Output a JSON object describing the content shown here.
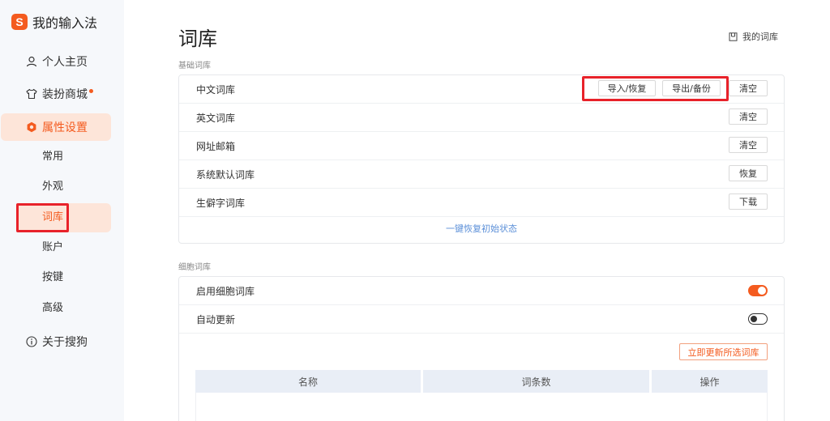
{
  "brand": {
    "logo_letter": "S",
    "name": "我的输入法",
    "color": "#f45b1f"
  },
  "sidebar": {
    "items": [
      {
        "label": "个人主页",
        "icon": "user-icon"
      },
      {
        "label": "装扮商城",
        "icon": "shirt-icon",
        "badge": true
      },
      {
        "label": "属性设置",
        "icon": "settings-icon",
        "active": true
      },
      {
        "label": "关于搜狗",
        "icon": "info-icon"
      }
    ],
    "sub_items": [
      "常用",
      "外观",
      "词库",
      "账户",
      "按键",
      "高级"
    ],
    "active_sub": "词库"
  },
  "main": {
    "title": "词库",
    "my_dict_label": "我的词库",
    "basic": {
      "section_label": "基础词库",
      "rows": [
        {
          "label": "中文词库",
          "buttons": [
            "导入/恢复",
            "导出/备份",
            "清空"
          ]
        },
        {
          "label": "英文词库",
          "buttons": [
            "清空"
          ]
        },
        {
          "label": "网址邮箱",
          "buttons": [
            "清空"
          ]
        },
        {
          "label": "系统默认词库",
          "buttons": [
            "恢复"
          ]
        },
        {
          "label": "生僻字词库",
          "buttons": [
            "下载"
          ]
        }
      ],
      "restore_all": "一键恢复初始状态"
    },
    "cell": {
      "section_label": "细胞词库",
      "rows": [
        {
          "label": "启用细胞词库",
          "toggle": true
        },
        {
          "label": "自动更新",
          "toggle": false
        }
      ],
      "update_button": "立即更新所选词库",
      "table_headers": [
        "名称",
        "词条数",
        "操作"
      ]
    }
  }
}
